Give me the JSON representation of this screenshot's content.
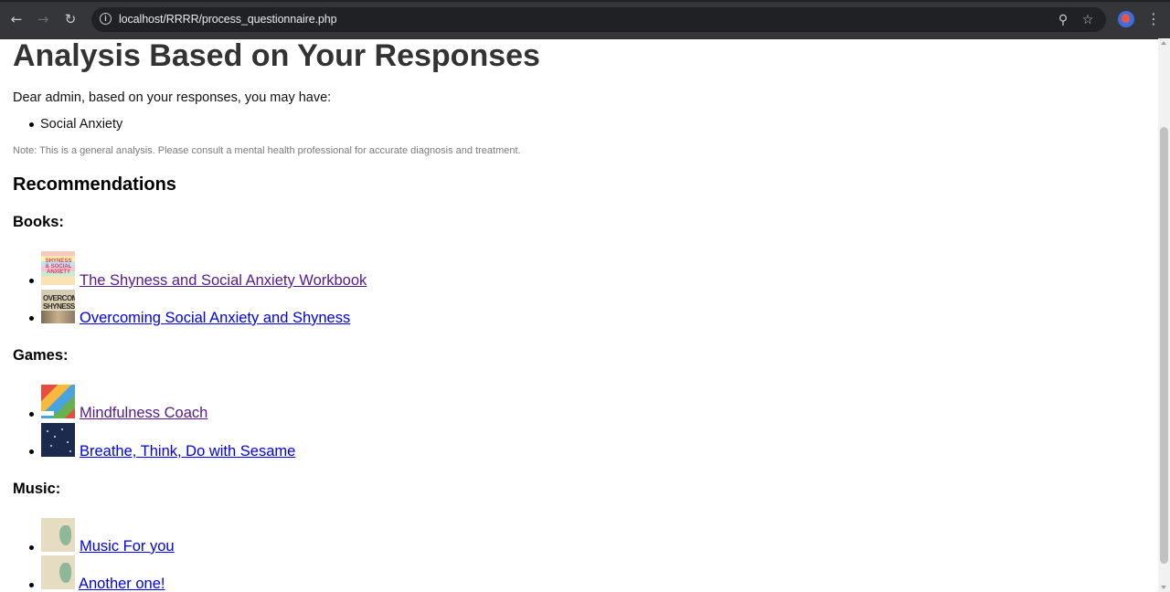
{
  "browser": {
    "url": "localhost/RRRR/process_questionnaire.php"
  },
  "page": {
    "heading": "Analysis Based on Your Responses",
    "intro": "Dear admin, based on your responses, you may have:",
    "conditions": [
      "Social Anxiety"
    ],
    "note": "Note: This is a general analysis. Please consult a mental health professional for accurate diagnosis and treatment.",
    "recommendations_title": "Recommendations",
    "books_title": "Books:",
    "books": [
      {
        "title": "The Shyness and Social Anxiety Workbook",
        "thumb_text": "SHYNESS & SOCIAL ANXIETY"
      },
      {
        "title": "Overcoming Social Anxiety and Shyness",
        "thumb_text": "OVERCOMING SHYNESS"
      }
    ],
    "games_title": "Games:",
    "games": [
      {
        "title": "Mindfulness Coach"
      },
      {
        "title": "Breathe, Think, Do with Sesame"
      }
    ],
    "music_title": "Music:",
    "music": [
      {
        "title": "Music For you"
      },
      {
        "title": "Another one!"
      }
    ]
  },
  "colors": {
    "visited_link": "#551a8b",
    "link": "#0000ee",
    "heading": "#333333",
    "chrome_bg": "#35363a"
  }
}
